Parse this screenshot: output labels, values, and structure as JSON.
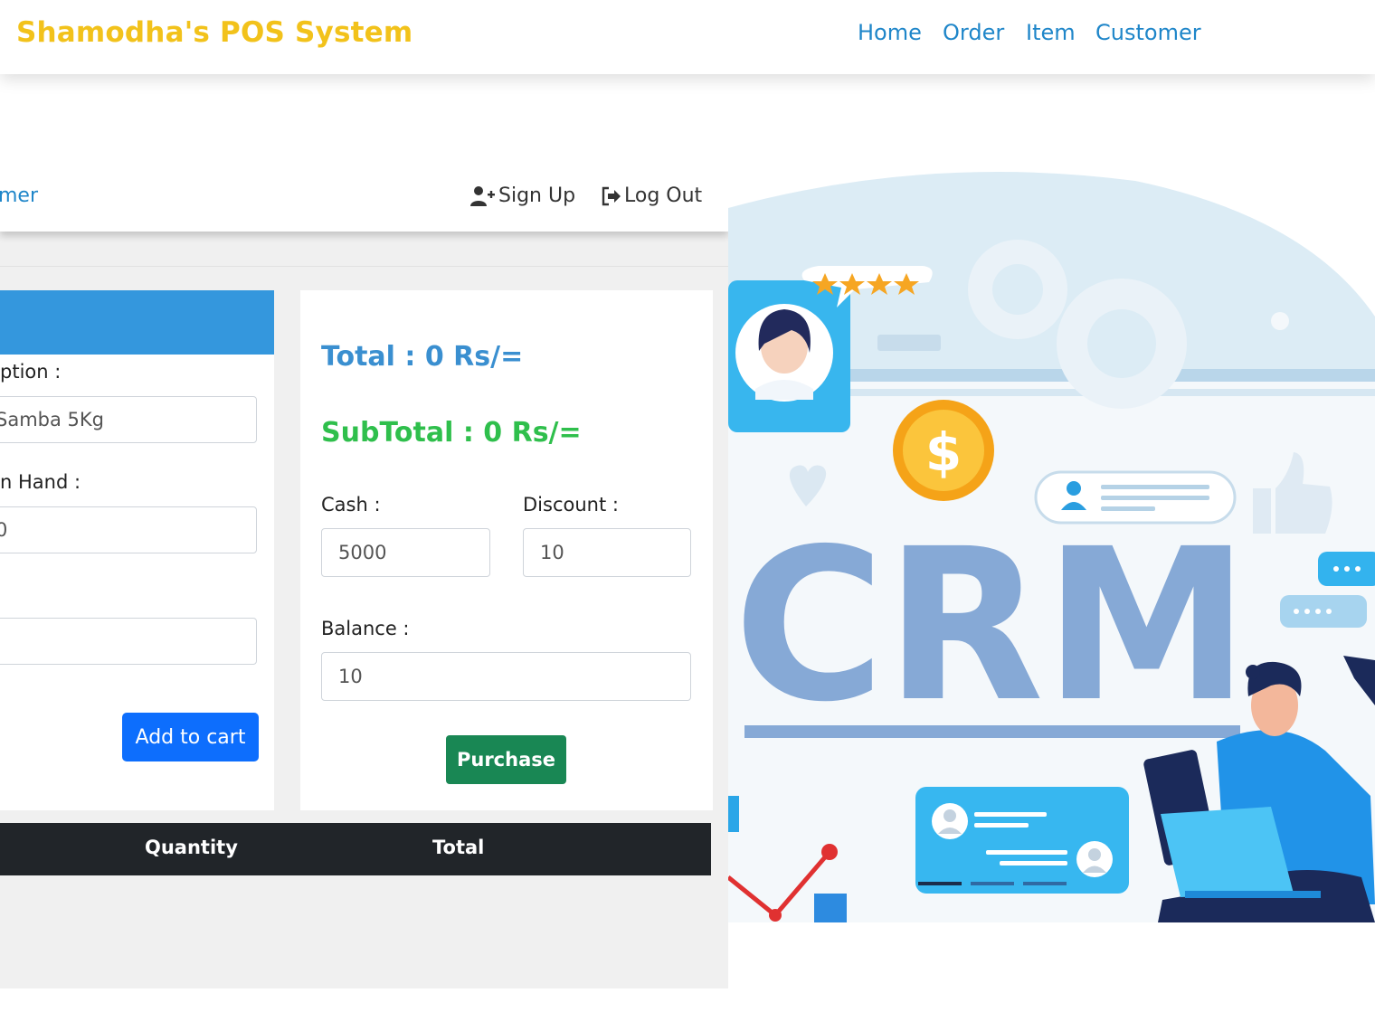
{
  "header": {
    "brand": "Shamodha's POS System",
    "nav": [
      "Home",
      "Order",
      "Item",
      "Customer"
    ]
  },
  "screenshot": {
    "nav_partial": "mer",
    "sign_up": "Sign Up",
    "log_out": "Log Out",
    "form": {
      "label_description": "ption :",
      "value_description": "Samba 5Kg",
      "label_qty_on_hand": "n Hand :",
      "value_qty_on_hand": "0",
      "value_third": "",
      "add_to_cart": "Add to cart"
    },
    "totals": {
      "total": "Total : 0 Rs/=",
      "subtotal": "SubTotal : 0 Rs/=",
      "cash_label": "Cash :",
      "cash_value": "5000",
      "discount_label": "Discount :",
      "discount_value": "10",
      "balance_label": "Balance :",
      "balance_value": "10",
      "purchase": "Purchase"
    },
    "table_headers": [
      "Quantity",
      "Total"
    ]
  },
  "illustration": {
    "crm_text": "CRM",
    "dollar": "$"
  },
  "colors": {
    "brand": "#f2c21b",
    "nav_link": "#1f86c9",
    "card_header": "#3497dd",
    "total_blue": "#3a8fd0",
    "subtotal_green": "#2fbf4c",
    "add_button": "#0d6efd",
    "purchase_button": "#198754",
    "table_header": "#212529"
  }
}
